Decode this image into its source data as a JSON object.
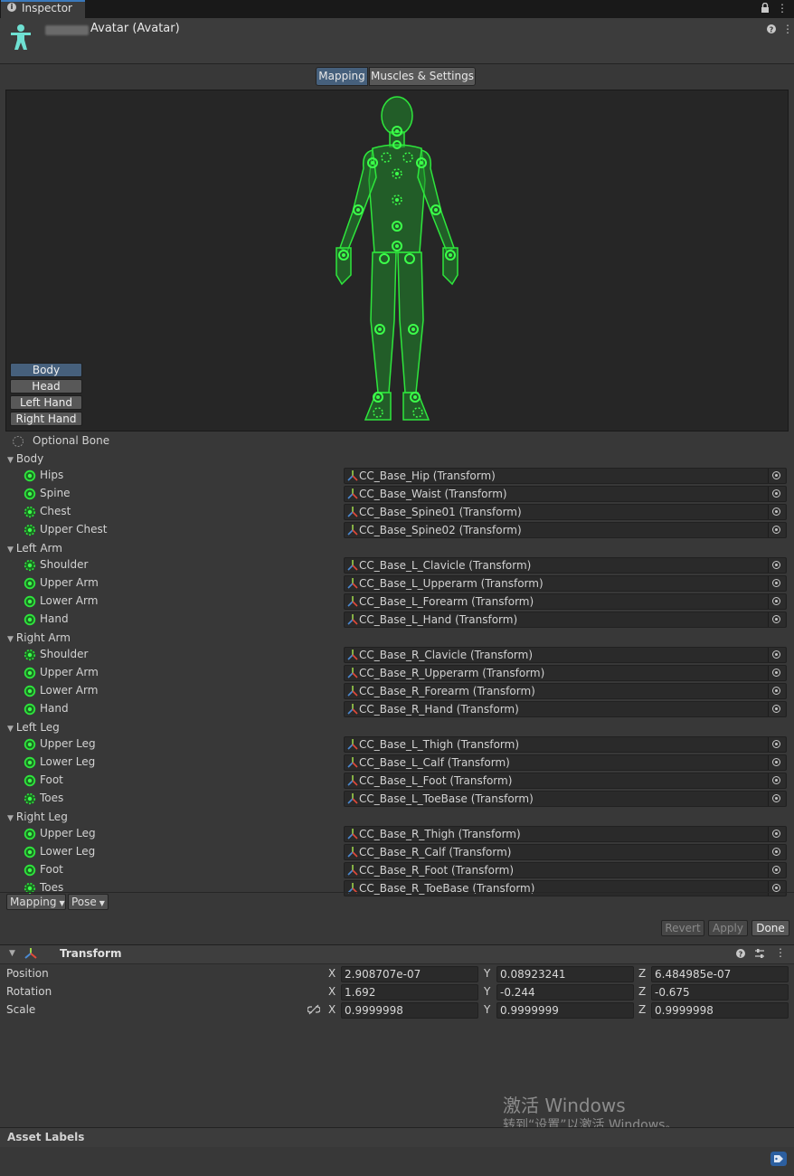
{
  "window": {
    "tab_label": "Inspector",
    "lock_icon": "lock-icon",
    "menu_icon": "kebab-menu-icon"
  },
  "header": {
    "title": "Avatar (Avatar)",
    "help_icon": "help-icon",
    "menu_icon": "kebab-menu-icon"
  },
  "toggle": {
    "mapping": "Mapping",
    "muscles": "Muscles & Settings"
  },
  "preview": {
    "parts": [
      "Body",
      "Head",
      "Left Hand",
      "Right Hand"
    ],
    "active_part": "Body"
  },
  "legend": {
    "optional": "Optional Bone"
  },
  "groups": [
    {
      "label": "Body",
      "bones": [
        {
          "name": "Hips",
          "value": "CC_Base_Hip (Transform)",
          "optional": false
        },
        {
          "name": "Spine",
          "value": "CC_Base_Waist (Transform)",
          "optional": false
        },
        {
          "name": "Chest",
          "value": "CC_Base_Spine01 (Transform)",
          "optional": true
        },
        {
          "name": "Upper Chest",
          "value": "CC_Base_Spine02 (Transform)",
          "optional": true
        }
      ]
    },
    {
      "label": "Left Arm",
      "bones": [
        {
          "name": "Shoulder",
          "value": "CC_Base_L_Clavicle (Transform)",
          "optional": true
        },
        {
          "name": "Upper Arm",
          "value": "CC_Base_L_Upperarm (Transform)",
          "optional": false
        },
        {
          "name": "Lower Arm",
          "value": "CC_Base_L_Forearm (Transform)",
          "optional": false
        },
        {
          "name": "Hand",
          "value": "CC_Base_L_Hand (Transform)",
          "optional": false
        }
      ]
    },
    {
      "label": "Right Arm",
      "bones": [
        {
          "name": "Shoulder",
          "value": "CC_Base_R_Clavicle (Transform)",
          "optional": true
        },
        {
          "name": "Upper Arm",
          "value": "CC_Base_R_Upperarm (Transform)",
          "optional": false
        },
        {
          "name": "Lower Arm",
          "value": "CC_Base_R_Forearm (Transform)",
          "optional": false
        },
        {
          "name": "Hand",
          "value": "CC_Base_R_Hand (Transform)",
          "optional": false
        }
      ]
    },
    {
      "label": "Left Leg",
      "bones": [
        {
          "name": "Upper Leg",
          "value": "CC_Base_L_Thigh (Transform)",
          "optional": false
        },
        {
          "name": "Lower Leg",
          "value": "CC_Base_L_Calf (Transform)",
          "optional": false
        },
        {
          "name": "Foot",
          "value": "CC_Base_L_Foot (Transform)",
          "optional": false
        },
        {
          "name": "Toes",
          "value": "CC_Base_L_ToeBase (Transform)",
          "optional": true
        }
      ]
    },
    {
      "label": "Right Leg",
      "bones": [
        {
          "name": "Upper Leg",
          "value": "CC_Base_R_Thigh (Transform)",
          "optional": false
        },
        {
          "name": "Lower Leg",
          "value": "CC_Base_R_Calf (Transform)",
          "optional": false
        },
        {
          "name": "Foot",
          "value": "CC_Base_R_Foot (Transform)",
          "optional": false
        },
        {
          "name": "Toes",
          "value": "CC_Base_R_ToeBase (Transform)",
          "optional": true
        }
      ]
    }
  ],
  "bottom": {
    "mapping_dropdown": "Mapping",
    "pose_dropdown": "Pose",
    "revert": "Revert",
    "apply": "Apply",
    "done": "Done"
  },
  "transform": {
    "title": "Transform",
    "axes": [
      "X",
      "Y",
      "Z"
    ],
    "position": {
      "label": "Position",
      "x": "2.908707e-07",
      "y": "0.08923241",
      "z": "6.484985e-07"
    },
    "rotation": {
      "label": "Rotation",
      "x": "1.692",
      "y": "-0.244",
      "z": "-0.675"
    },
    "scale": {
      "label": "Scale",
      "x": "0.9999998",
      "y": "0.9999999",
      "z": "0.9999998"
    }
  },
  "watermark": {
    "line1": "激活 Windows",
    "line2": "转到“设置”以激活 Windows。"
  },
  "asset_labels": {
    "title": "Asset Labels"
  },
  "colors": {
    "accent": "#3a79bb",
    "bone_green": "#1fd32c",
    "toggle_active": "#46607c",
    "panel": "#383838"
  }
}
